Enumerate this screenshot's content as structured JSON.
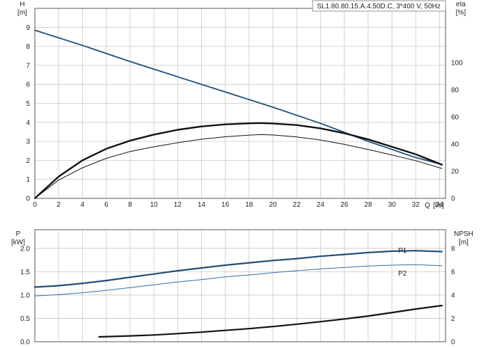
{
  "chart_data": [
    {
      "type": "line",
      "title": "SL1.80.80.15.A.4.50D.C, 3*400 V, 50Hz",
      "xlabel": "Q",
      "xunit": "[l/s]",
      "ylabel": "H",
      "yunit": "[m]",
      "y2label": "eta",
      "y2unit": "[%]",
      "xlim": [
        0,
        34.5
      ],
      "ylim": [
        0,
        10
      ],
      "y2lim": [
        0,
        140
      ],
      "xticks": [
        0,
        2,
        4,
        6,
        8,
        10,
        12,
        14,
        16,
        18,
        20,
        22,
        24,
        26,
        28,
        30,
        32,
        34
      ],
      "yticks": [
        0,
        1,
        2,
        3,
        4,
        5,
        6,
        7,
        8,
        9
      ],
      "y2ticks": [
        0,
        20,
        40,
        60,
        80,
        100
      ],
      "grid": true,
      "series": [
        {
          "axis": "left",
          "color": "#1f4e79",
          "x": [
            0,
            4,
            8,
            12,
            16,
            20,
            24,
            28,
            32,
            34.2
          ],
          "y": [
            8.85,
            8.05,
            7.2,
            6.4,
            5.6,
            4.8,
            3.95,
            3.0,
            2.15,
            1.78
          ]
        },
        {
          "axis": "right",
          "color": "#111111",
          "x": [
            0,
            2,
            4,
            6,
            8,
            10,
            12,
            14,
            16,
            18,
            19,
            20,
            22,
            24,
            26,
            28,
            30,
            32,
            34.2
          ],
          "y": [
            0,
            16,
            28,
            36.5,
            42.5,
            47,
            50.5,
            53,
            54.5,
            55.3,
            55.5,
            55.2,
            54,
            51.6,
            48,
            43.5,
            38,
            32.5,
            24.8
          ]
        },
        {
          "axis": "right",
          "color": "#111111",
          "x": [
            0,
            2,
            4,
            6,
            8,
            10,
            12,
            14,
            16,
            18,
            19,
            20,
            22,
            24,
            26,
            28,
            30,
            32,
            34.2
          ],
          "y": [
            0,
            13.5,
            22.5,
            29.5,
            34.5,
            38,
            41,
            43.6,
            45.4,
            46.6,
            47,
            46.7,
            45.3,
            43,
            39.8,
            36,
            32,
            27.8,
            22
          ]
        }
      ]
    },
    {
      "type": "line",
      "xlabel": "",
      "ylabel": "P",
      "yunit": "[kW]",
      "y2label": "NPSH",
      "y2unit": "[m]",
      "xlim": [
        0,
        34.5
      ],
      "ylim": [
        0,
        2.4
      ],
      "y2lim": [
        0,
        9.6
      ],
      "yticks": [
        "0.0",
        "0.5",
        "1.0",
        "1.5",
        "2.0"
      ],
      "y2ticks": [
        0,
        2,
        4,
        6,
        8
      ],
      "grid": true,
      "series": [
        {
          "name": "P1",
          "axis": "left",
          "color": "#1f4e79",
          "x": [
            0,
            2,
            4,
            6,
            8,
            10,
            12,
            14,
            16,
            18,
            20,
            22,
            24,
            26,
            28,
            30,
            32,
            34.2
          ],
          "y": [
            1.17,
            1.2,
            1.25,
            1.31,
            1.38,
            1.45,
            1.52,
            1.58,
            1.64,
            1.69,
            1.74,
            1.78,
            1.83,
            1.87,
            1.91,
            1.94,
            1.95,
            1.93
          ]
        },
        {
          "name": "P2",
          "axis": "left",
          "color": "#2e6da4",
          "x": [
            0,
            2,
            4,
            6,
            8,
            10,
            12,
            14,
            16,
            18,
            20,
            22,
            24,
            26,
            28,
            30,
            32,
            34.2
          ],
          "y": [
            0.98,
            1.01,
            1.05,
            1.1,
            1.16,
            1.22,
            1.28,
            1.33,
            1.39,
            1.43,
            1.48,
            1.52,
            1.56,
            1.59,
            1.62,
            1.64,
            1.65,
            1.63
          ]
        },
        {
          "axis": "right",
          "color": "#111111",
          "x": [
            5.4,
            8,
            10,
            12,
            14,
            16,
            18,
            20,
            22,
            24,
            26,
            28,
            30,
            32,
            34.2
          ],
          "y": [
            0.42,
            0.5,
            0.58,
            0.7,
            0.82,
            0.97,
            1.12,
            1.3,
            1.5,
            1.72,
            1.95,
            2.2,
            2.5,
            2.8,
            3.1
          ]
        }
      ]
    }
  ]
}
